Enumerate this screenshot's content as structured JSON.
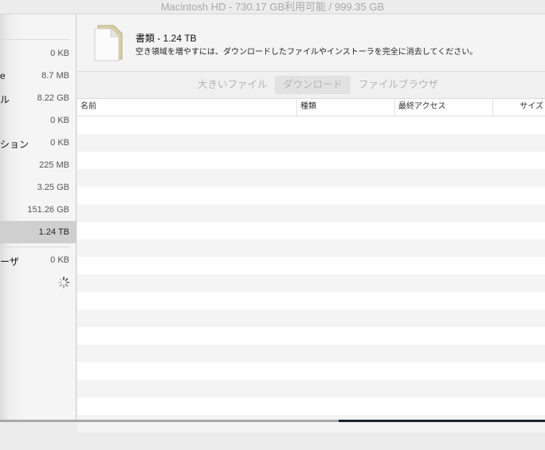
{
  "window_title": "Macintosh HD - 730.17 GB利用可能 / 999.35 GB",
  "sidebar": {
    "items": [
      {
        "label": "",
        "size": "0 KB"
      },
      {
        "label": "e",
        "size": "8.7 MB"
      },
      {
        "label": "ル",
        "size": "8.22 GB"
      },
      {
        "label": "",
        "size": "0 KB"
      },
      {
        "label": "ション",
        "size": "0 KB"
      },
      {
        "label": "",
        "size": "225 MB"
      },
      {
        "label": "",
        "size": "3.25 GB"
      },
      {
        "label": "",
        "size": "151.26 GB"
      },
      {
        "label": "",
        "size": "1.24 TB",
        "selected": true
      },
      {
        "label": "ーザ",
        "size": "0 KB"
      }
    ]
  },
  "header": {
    "title": "書類 - 1.24 TB",
    "subtitle": "空き領域を増やすには、ダウンロードしたファイルやインストーラを完全に消去してください。"
  },
  "tabs": [
    {
      "label": "大きいファイル"
    },
    {
      "label": "ダウンロード",
      "active": true
    },
    {
      "label": "ファイルブラウザ"
    }
  ],
  "table": {
    "columns": [
      "名前",
      "種類",
      "最終アクセス",
      "サイズ"
    ],
    "rows": []
  }
}
